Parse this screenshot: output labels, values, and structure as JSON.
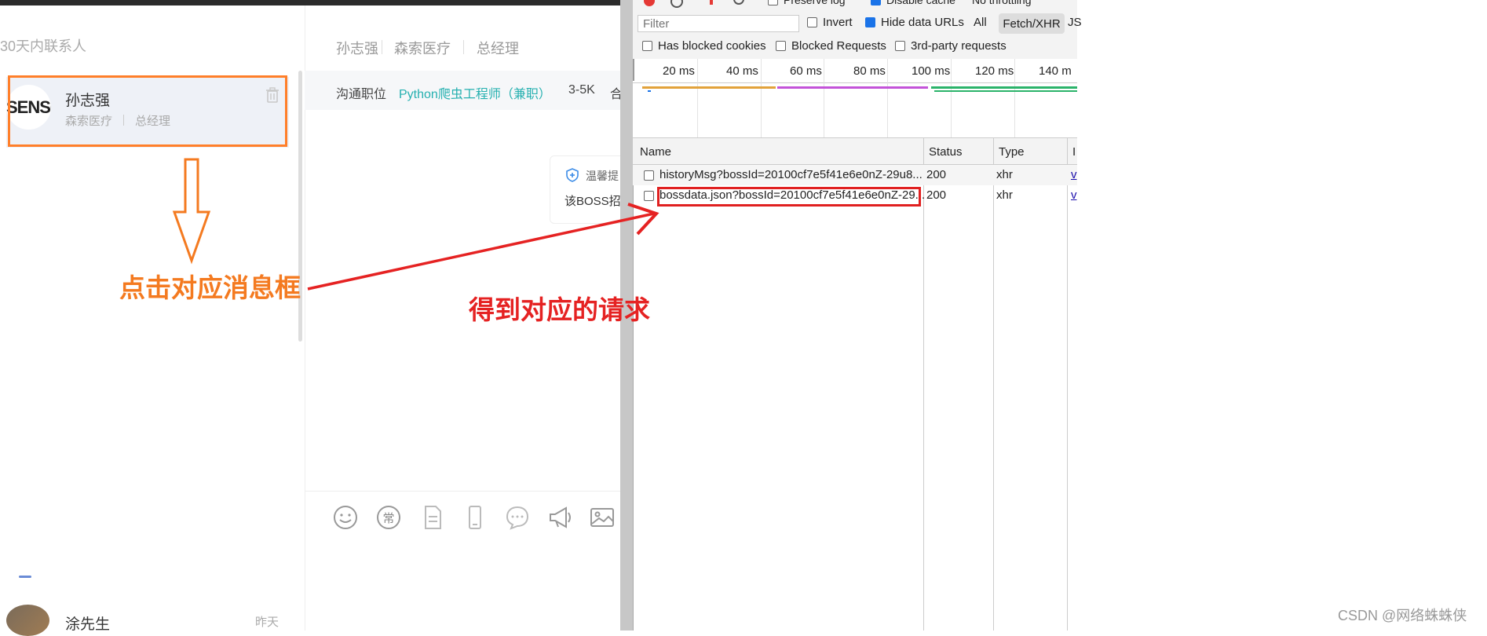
{
  "chat": {
    "contacts_header": "30天内联系人",
    "selected_contact": {
      "avatar_text": "SENSO",
      "name": "孙志强",
      "company": "森索医疗",
      "title": "总经理"
    },
    "other_contact": {
      "name": "涂先生",
      "time": "昨天"
    },
    "header": {
      "name": "孙志强",
      "company": "森索医疗",
      "title": "总经理"
    },
    "job": {
      "label": "沟通职位",
      "name": "Python爬虫工程师（兼职）",
      "salary": "3-5K",
      "cut": "合"
    },
    "tip": {
      "title": "温馨提",
      "text": "该BOSS招"
    }
  },
  "devtools": {
    "top_labels": {
      "preserve": "Preserve log",
      "disable": "Disable cache",
      "throttle": "No throttling"
    },
    "filter_placeholder": "Filter",
    "invert": "Invert",
    "hide_data_urls": "Hide data URLs",
    "all": "All",
    "fetch_xhr": "Fetch/XHR",
    "js": "JS",
    "has_blocked_cookies": "Has blocked cookies",
    "blocked_requests": "Blocked Requests",
    "third_party": "3rd-party requests",
    "ticks": [
      "20 ms",
      "40 ms",
      "60 ms",
      "80 ms",
      "100 ms",
      "120 ms",
      "140 m"
    ],
    "columns": {
      "name": "Name",
      "status": "Status",
      "type": "Type",
      "initiator": "I"
    },
    "rows": [
      {
        "name": "historyMsg?bossId=20100cf7e5f41e6e0nZ-29u8...",
        "status": "200",
        "type": "xhr",
        "initiator": "v"
      },
      {
        "name": "bossdata.json?bossId=20100cf7e5f41e6e0nZ-29...",
        "status": "200",
        "type": "xhr",
        "initiator": "v"
      }
    ]
  },
  "annotations": {
    "click_label": "点击对应消息框",
    "request_label": "得到对应的请求"
  },
  "watermark": "CSDN @网络蛛蛛侠"
}
